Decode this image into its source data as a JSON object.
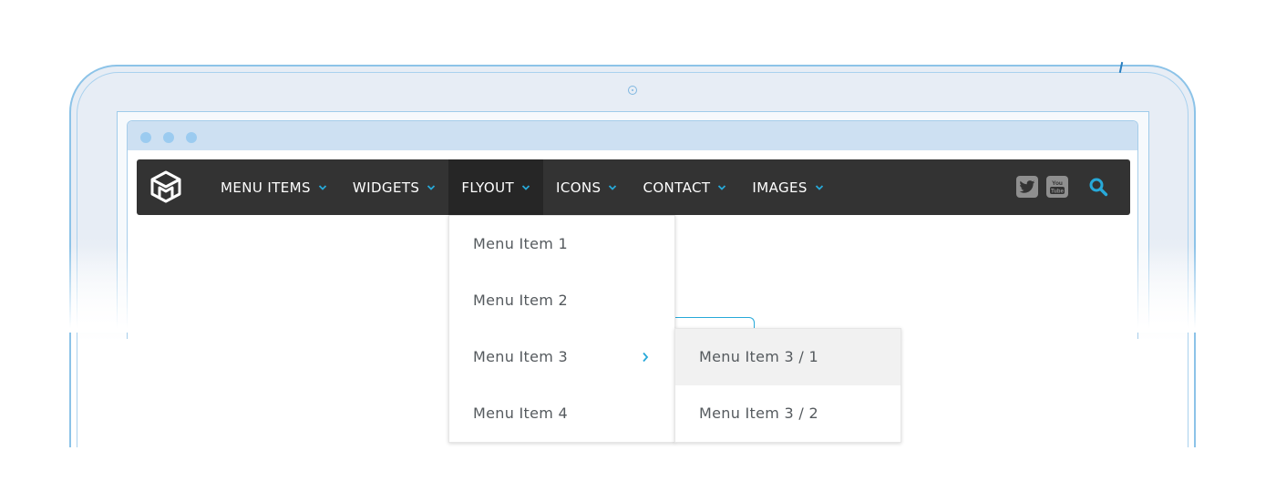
{
  "nav": {
    "items": [
      {
        "label": "MENU ITEMS"
      },
      {
        "label": "WIDGETS"
      },
      {
        "label": "FLYOUT"
      },
      {
        "label": "ICONS"
      },
      {
        "label": "CONTACT"
      },
      {
        "label": "IMAGES"
      }
    ],
    "active": "FLYOUT",
    "social": {
      "twitter_icon": "twitter-icon",
      "youtube_label": "You Tube",
      "search_icon": "search-icon"
    }
  },
  "dropdown": {
    "items": [
      {
        "label": "Menu Item 1"
      },
      {
        "label": "Menu Item 2"
      },
      {
        "label": "Menu Item 3"
      },
      {
        "label": "Menu Item 4"
      }
    ]
  },
  "submenu": {
    "items": [
      {
        "label": "Menu Item 3 / 1"
      },
      {
        "label": "Menu Item 3 / 2"
      }
    ]
  },
  "colors": {
    "navbar_bg": "#333333",
    "accent": "#27a9d9",
    "frame": "#8cc3e8"
  }
}
